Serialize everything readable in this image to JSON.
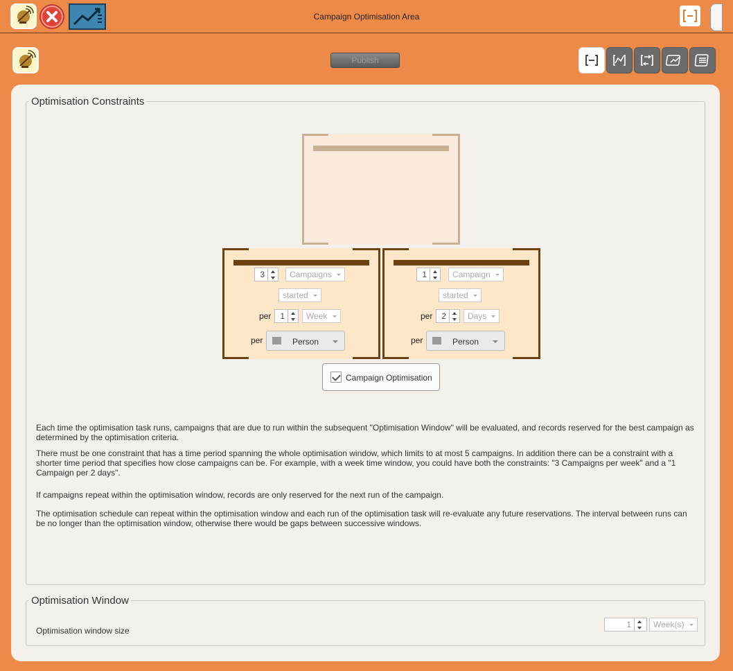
{
  "window": {
    "title": "Campaign Optimisation Area"
  },
  "toolbar": {
    "publish_label": "Publish",
    "view_buttons": [
      "design-view",
      "chart-view",
      "flow-view",
      "report-view",
      "list-view"
    ]
  },
  "constraints": {
    "legend": "Optimisation Constraints",
    "items": [
      {
        "count": "3",
        "unit": "Campaigns",
        "event": "started",
        "per_label": "per",
        "period_count": "1",
        "period_unit": "Week",
        "per2_label": "per",
        "entity": "Person"
      },
      {
        "count": "1",
        "unit": "Campaign",
        "event": "started",
        "per_label": "per",
        "period_count": "2",
        "period_unit": "Days",
        "per2_label": "per",
        "entity": "Person"
      }
    ],
    "checkbox_label": "Campaign Optimisation",
    "checkbox_checked": true,
    "paragraphs": [
      "Each time the optimisation task runs, campaigns that are due to run within the subsequent \"Optimisation Window\" will be evaluated, and records reserved for the best campaign as determined by the optimisation criteria.",
      "There must be one constraint that has a time period spanning the whole optimisation window, which limits to at most 5 campaigns.  In addition there can be a constraint with a shorter time period that specifies how close campaigns can be.  For example, with a week time window, you could have both the constraints: \"3 Campaigns per week\" and a \"1 Campaign per 2 days\".",
      "If campaigns repeat within the optimisation window, records are only reserved for the next run of the campaign.",
      "The optimisation schedule can repeat within the optimisation window and each run of the optimisation task will re-evaluate any future reservations.  The interval between runs can be no longer than the optimisation window, otherwise there would be gaps between successive windows."
    ]
  },
  "window_group": {
    "legend": "Optimisation Window",
    "size_label": "Optimisation window size",
    "size_value": "1",
    "size_unit": "Week(s)"
  },
  "colors": {
    "background": "#ee8a48",
    "panel": "#f4f0ec",
    "constraint_fill": "#fde7c8",
    "constraint_border": "#6b4210",
    "root_border": "#c8b096"
  }
}
